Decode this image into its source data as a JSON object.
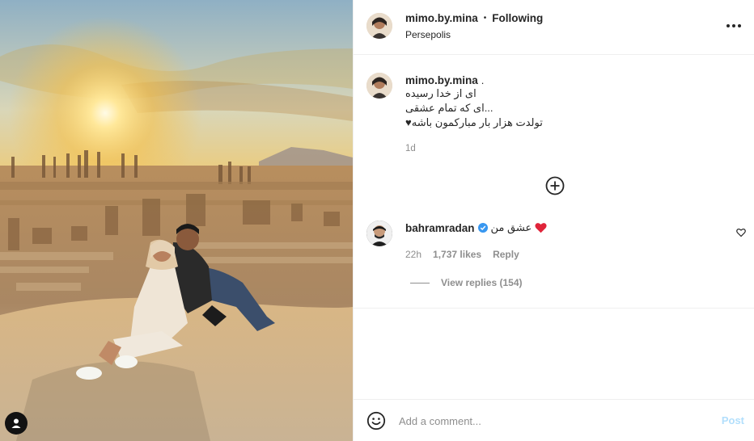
{
  "post": {
    "username": "mimo.by.mina",
    "separator": "•",
    "follow_status": "Following",
    "location": "Persepolis"
  },
  "caption": {
    "username": "mimo.by.mina",
    "suffix": ".",
    "lines": [
      "ای از خدا رسیده",
      "...ای که تمام عشقی",
      "تولدت هزار بار مبارکمون باشه♥"
    ],
    "time": "1d"
  },
  "comment": {
    "username": "bahramradan",
    "text": "عشق من",
    "time": "22h",
    "likes": "1,737 likes",
    "reply_label": "Reply",
    "view_replies": "View replies (154)"
  },
  "composer": {
    "placeholder": "Add a comment...",
    "post_label": "Post"
  },
  "colors": {
    "verified": "#3897f0",
    "heart": "#ed4956",
    "post_disabled": "#b2dffc",
    "muted_text": "#8e8e8e"
  },
  "icons": [
    "user-tag-icon",
    "more-options-icon",
    "load-more-comments-icon",
    "verified-badge-icon",
    "red-heart-emoji-icon",
    "like-heart-icon",
    "emoji-icon"
  ]
}
